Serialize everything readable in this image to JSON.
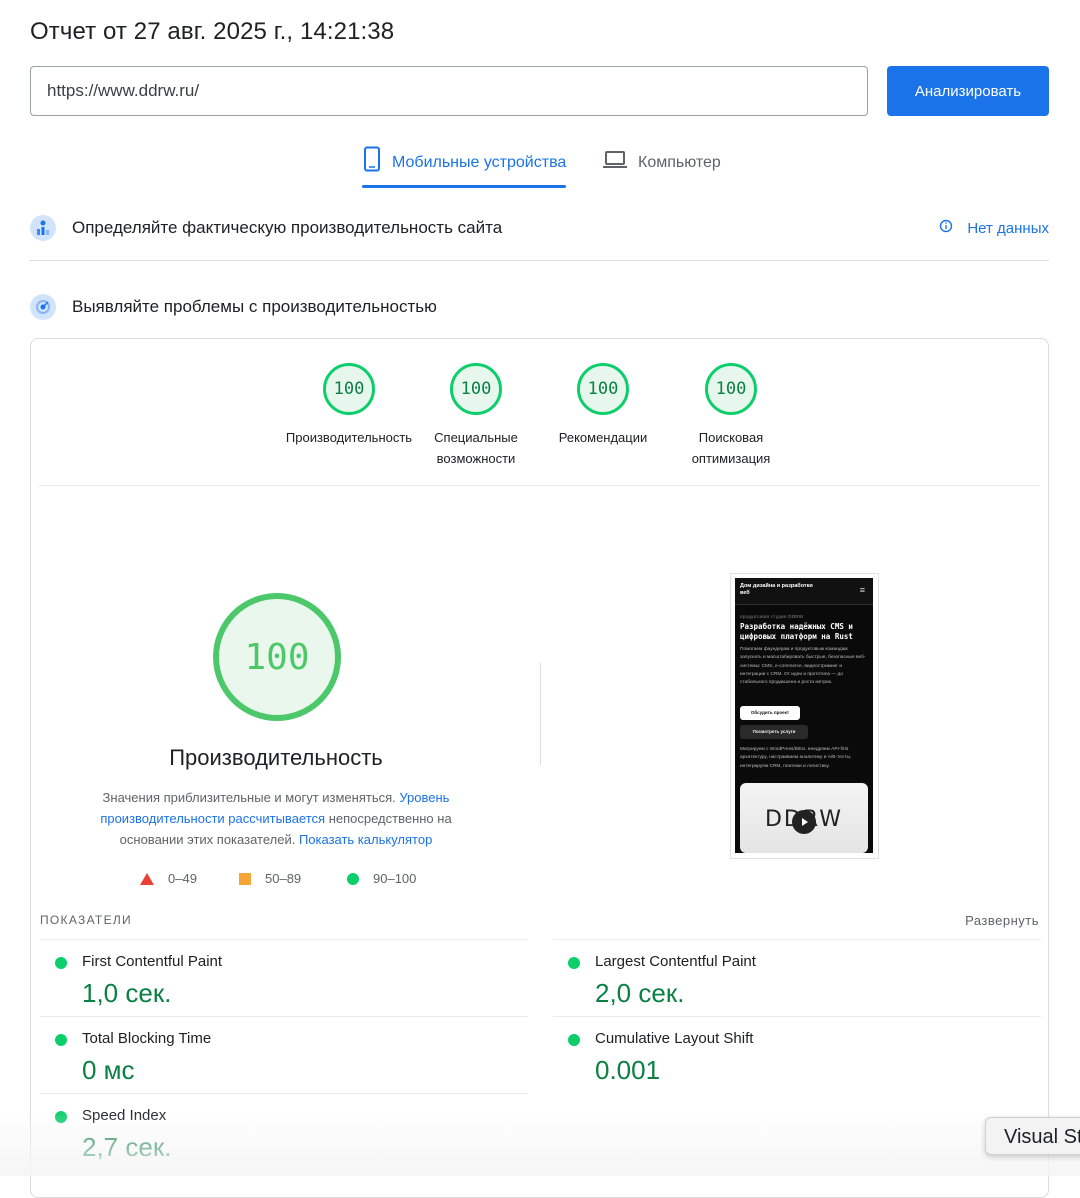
{
  "header": {
    "title": "Отчет от 27 авг. 2025 г., 14:21:38"
  },
  "search": {
    "url": "https://www.ddrw.ru/",
    "analyze_label": "Анализировать"
  },
  "tabs": [
    {
      "label": "Мобильные устройства",
      "icon": "smartphone-icon",
      "active": true
    },
    {
      "label": "Компьютер",
      "icon": "laptop-icon",
      "active": false
    }
  ],
  "field_data": {
    "title": "Определяйте фактическую производительность сайта",
    "no_data_label": "Нет данных"
  },
  "lab_data": {
    "title": "Выявляйте проблемы с производительностью"
  },
  "categories": [
    {
      "score": "100",
      "label": "Производительность"
    },
    {
      "score": "100",
      "label": "Специальные возможности"
    },
    {
      "score": "100",
      "label": "Рекомендации"
    },
    {
      "score": "100",
      "label": "Поисковая оптимизация"
    }
  ],
  "performance": {
    "score": "100",
    "title": "Производительность",
    "desc_part1": "Значения приблизительные и могут изменяться. ",
    "desc_link1": "Уровень производительности рассчитывается",
    "desc_part2": " непосредственно на основании этих показателей. ",
    "desc_link2": "Показать калькулятор"
  },
  "legend": [
    {
      "range": "0–49",
      "color": "#eb3f36"
    },
    {
      "range": "50–89",
      "color": "#f4a536"
    },
    {
      "range": "90–100",
      "color": "#0cce6b"
    }
  ],
  "screenshot": {
    "brand": "Дом дизайна и разработки веб",
    "tag": "продуктовая студия DDRW",
    "heading": "Разработка надёжных CMS и цифровых платформ на Rust",
    "paragraph": "Помогаем фаундерам и продуктовым командам запускать и масштабировать быстрые, безопасные веб-системы: CMS, e-commerce, видеостриминг и интеграции с CRM. От идеи и прототипа — до стабильного продакшена и роста метрик.",
    "button_primary": "Обсудить проект",
    "button_secondary": "Посмотреть услуги",
    "paragraph2": "Мигрируем с WordPress/Bitrix, внедряем API-first архитектуру, настраиваем аналитику и A/B-тесты, интегрируем CRM, платежи и логистику.",
    "logo": "DDRW"
  },
  "metrics": {
    "label": "ПОКАЗАТЕЛИ",
    "expand_label": "Развернуть",
    "items": [
      {
        "name": "First Contentful Paint",
        "value": "1,0 сек."
      },
      {
        "name": "Largest Contentful Paint",
        "value": "2,0 сек."
      },
      {
        "name": "Total Blocking Time",
        "value": "0 мс"
      },
      {
        "name": "Cumulative Layout Shift",
        "value": "0.001"
      },
      {
        "name": "Speed Index",
        "value": "2,7 сек."
      }
    ]
  },
  "overlay": {
    "visual_studio_label": "Visual Studio"
  }
}
